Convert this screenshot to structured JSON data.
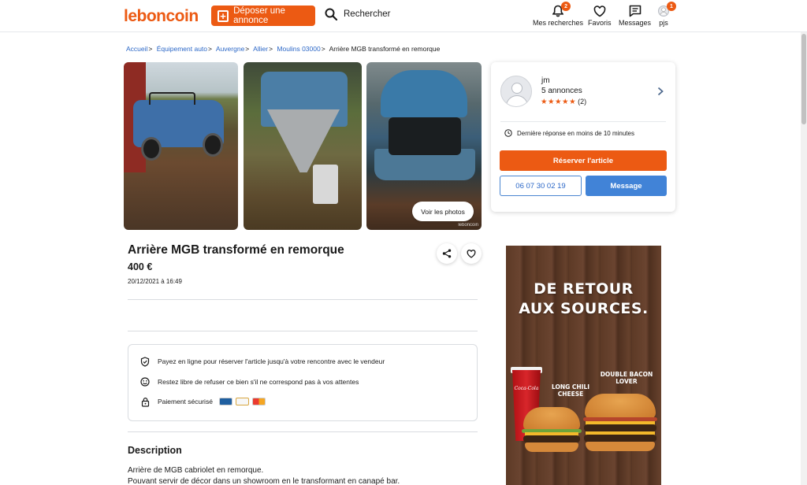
{
  "header": {
    "logo": "leboncoin",
    "post_button": "Déposer une annonce",
    "search_label": "Rechercher",
    "nav": [
      {
        "label": "Mes recherches",
        "icon": "bell-icon",
        "badge": "2"
      },
      {
        "label": "Favoris",
        "icon": "heart-icon",
        "badge": ""
      },
      {
        "label": "Messages",
        "icon": "messages-icon",
        "badge": ""
      },
      {
        "label": "pjs",
        "icon": "user-icon",
        "badge": "1"
      }
    ]
  },
  "breadcrumb": [
    {
      "label": "Accueil",
      "link": true
    },
    {
      "label": "Équipement auto",
      "link": true
    },
    {
      "label": "Auvergne",
      "link": true
    },
    {
      "label": "Allier",
      "link": true
    },
    {
      "label": "Moulins 03000",
      "link": true
    },
    {
      "label": "Arrière MGB transformé en remorque",
      "link": false
    }
  ],
  "gallery": {
    "see_photos": "Voir les photos",
    "watermark": "leboncoin"
  },
  "listing": {
    "title": "Arrière MGB transformé en remorque",
    "price": "400 €",
    "date": "20/12/2021 à 16:49"
  },
  "security": {
    "rows": [
      "Payez en ligne pour réserver l'article jusqu'à votre rencontre avec le vendeur",
      "Restez libre de refuser ce bien s'il ne correspond pas à vos attentes",
      "Paiement sécurisé"
    ],
    "cards": [
      "CB",
      "VISA",
      "Mastercard"
    ]
  },
  "description": {
    "title": "Description",
    "lines": [
      "Arrière de MGB cabriolet en remorque.",
      "Pouvant servir de décor dans un showroom en le transformant en canapé bar."
    ]
  },
  "seller": {
    "name": "jm",
    "ads": "5 annonces",
    "stars": "★★★★★",
    "rating_count": "(2)",
    "response": "Dernière réponse en moins de 10 minutes",
    "reserve_button": "Réserver l'article",
    "phone": "06 07 30 02 19",
    "message_button": "Message"
  },
  "ad": {
    "headline_1": "DE RETOUR",
    "headline_2": "AUX SOURCES.",
    "product_1": "LONG CHILI CHEESE",
    "product_2": "DOUBLE BACON LOVER",
    "cup_brand": "Coca-Cola"
  },
  "colors": {
    "brand_orange": "#ec5a13",
    "link_blue": "#2b67c7",
    "message_blue": "#4183d7"
  }
}
